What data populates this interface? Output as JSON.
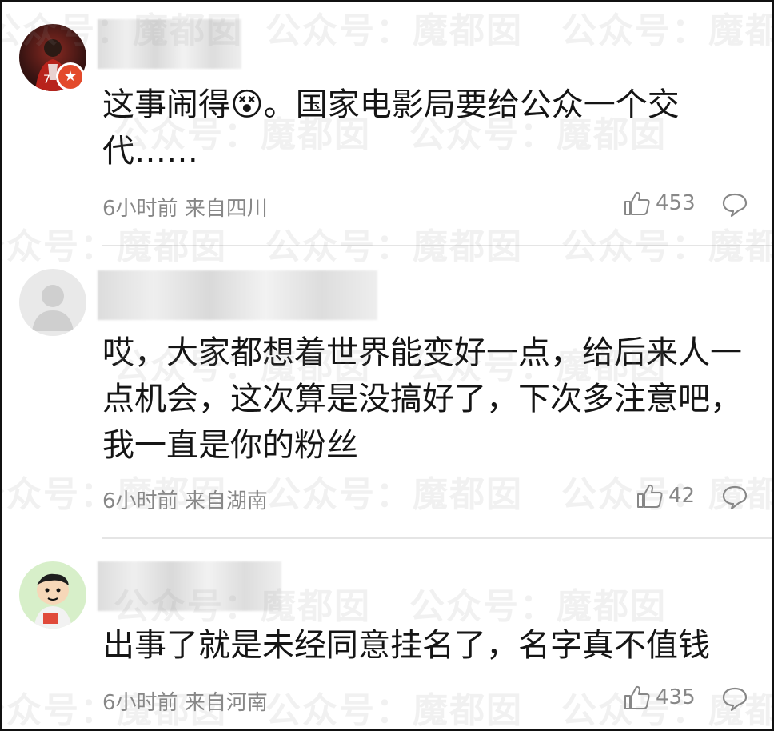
{
  "comments": [
    {
      "text": "这事闹得😵。国家电影局要给公众一个交代……",
      "time": "6小时前",
      "location": "来自四川",
      "likes": "453"
    },
    {
      "text": "哎，大家都想着世界能变好一点，给后来人一点机会，这次算是没搞好了，下次多注意吧，我一直是你的粉丝",
      "time": "6小时前",
      "location": "来自湖南",
      "likes": "42"
    },
    {
      "text": "出事了就是未经同意挂名了，名字真不值钱",
      "time": "6小时前",
      "location": "来自河南",
      "likes": "435"
    }
  ],
  "watermark": "公众号：魔都囡",
  "icons": {
    "like": "thumbs-up-icon",
    "reply": "comment-bubble-icon",
    "badge": "verified-star-icon"
  },
  "colors": {
    "text": "#151515",
    "meta": "#878787",
    "badge": "#e34a2b",
    "divider": "#e5e5e5"
  }
}
